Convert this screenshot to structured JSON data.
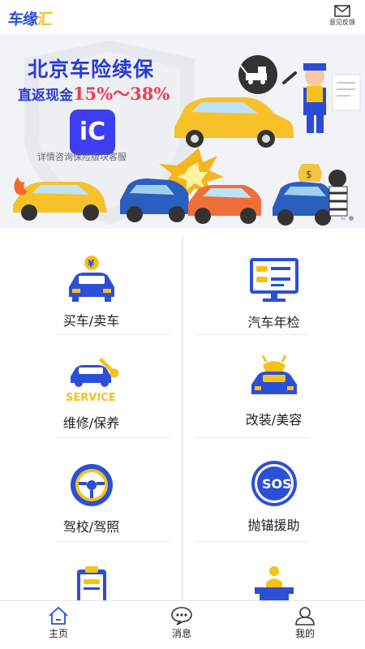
{
  "header": {
    "logo_main": "车缘",
    "logo_accent": "汇",
    "feedback_label": "意见反馈",
    "feedback_icon": "mail-icon"
  },
  "banner": {
    "title": "北京车险续保",
    "subtitle_prefix": "直返现金",
    "subtitle_pct": "15%～38%",
    "badge": "iC",
    "caption": "详情咨询保险版块客服",
    "colors": {
      "title": "#2a3bd6",
      "pct": "#ef3d4f",
      "badge": "#3d3ef0"
    }
  },
  "services": [
    {
      "id": "buy-sell",
      "label": "买车/卖车",
      "icon": "car-coin-icon"
    },
    {
      "id": "inspection",
      "label": "汽车年检",
      "icon": "monitor-cars-icon"
    },
    {
      "id": "repair",
      "label": "维修/保养",
      "icon": "service-car-icon",
      "icon_text": "SERVICE"
    },
    {
      "id": "modify",
      "label": "改装/美容",
      "icon": "car-decor-icon"
    },
    {
      "id": "driving-school",
      "label": "驾校/驾照",
      "icon": "steering-wheel-icon"
    },
    {
      "id": "rescue",
      "label": "抛锚援助",
      "icon": "sos-badge-icon",
      "icon_text": "SOS"
    },
    {
      "id": "item7",
      "label": "",
      "icon": "clipboard-car-icon"
    },
    {
      "id": "item8",
      "label": "",
      "icon": "desk-person-icon"
    }
  ],
  "nav": {
    "items": [
      {
        "label": "主页",
        "icon": "home-icon",
        "active": true
      },
      {
        "label": "消息",
        "icon": "chat-bubble-icon",
        "active": false
      },
      {
        "label": "我的",
        "icon": "user-icon",
        "active": false
      }
    ]
  },
  "theme": {
    "primary": "#2c4fd8",
    "accent": "#f5c21b"
  }
}
